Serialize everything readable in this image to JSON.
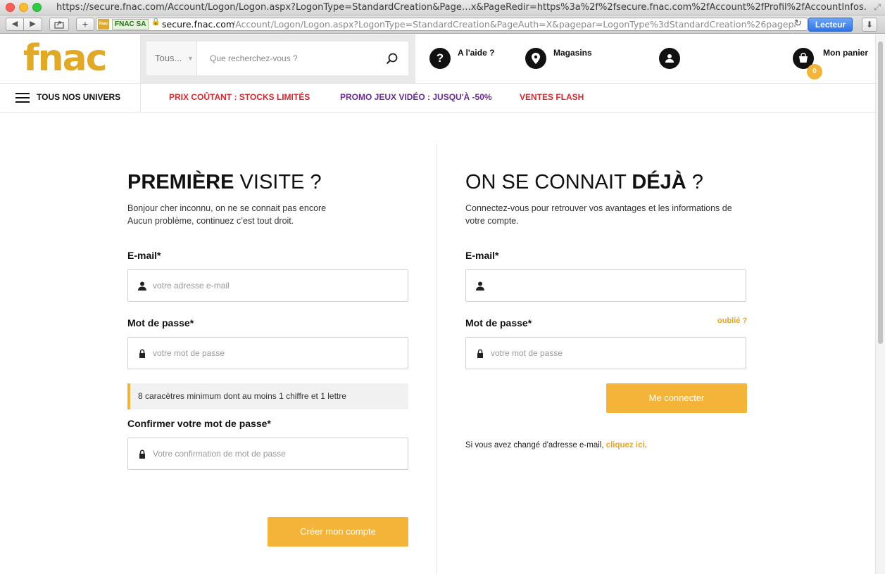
{
  "browser": {
    "window_title": "https://secure.fnac.com/Account/Logon/Logon.aspx?LogonType=StandardCreation&Page…x&PageRedir=https%3a%2f%2fsecure.fnac.com%2fAccount%2fProfil%2fAccountInfos.aspx",
    "site_badge": "FNAC SA",
    "site_mini_logo": "fnac",
    "url_domain": "secure.fnac.com",
    "url_path": "/Account/Logon/Logon.aspx?LogonType=StandardCreation&PageAuth=X&pagepar=LogonType%3dStandardCreation%26pagepar%3dLog",
    "reader_label": "Lecteur",
    "icons": [
      "back-icon",
      "forward-icon",
      "share-icon",
      "plus-icon",
      "lock-icon",
      "reload-icon",
      "download-icon"
    ]
  },
  "header": {
    "logo": "fnac",
    "search": {
      "category": "Tous...",
      "placeholder": "Que recherchez-vous ?"
    },
    "help_label": "A l'aide ?",
    "help_glyph": "?",
    "stores_label": "Magasins",
    "cart_label": "Mon panier",
    "cart_count": "0"
  },
  "subnav": {
    "univers_label": "TOUS NOS UNIVERS",
    "promos": [
      {
        "label": "PRIX COÛTANT : STOCKS LIMITÉS",
        "color": "#d7282f"
      },
      {
        "label": "PROMO JEUX VIDÉO : JUSQU'À -50%",
        "color": "#6b2c91"
      },
      {
        "label": "VENTES FLASH",
        "color": "#d7282f"
      }
    ]
  },
  "signup": {
    "title_bold": "PREMIÈRE",
    "title_light": " VISITE ?",
    "intro_line1": "Bonjour cher inconnu, on ne se connait pas encore",
    "intro_line2": "Aucun problème, continuez c’est tout droit.",
    "email_label": "E-mail*",
    "email_placeholder": "votre adresse e-mail",
    "password_label": "Mot de passe*",
    "password_placeholder": "votre mot de passe",
    "password_hint": "8 caracètres minimum dont au moins 1 chiffre et 1 lettre",
    "confirm_label": "Confirmer votre mot de passe*",
    "confirm_placeholder": "Votre confirmation de mot de passe",
    "submit_label": "Créer mon compte"
  },
  "login": {
    "title_light": "ON SE CONNAIT ",
    "title_bold": "DÉJÀ",
    "title_end": " ?",
    "intro_line1": "Connectez-vous pour retrouver vos avantages et les informations de",
    "intro_line2": "votre compte.",
    "email_label": "E-mail*",
    "email_value": "",
    "password_label": "Mot de passe*",
    "forgot_label": "oublié ?",
    "password_placeholder": "votre mot de passe",
    "submit_label": "Me connecter",
    "changed_text": "Si vous avez changé d'adresse e-mail, ",
    "changed_link": "cliquez ici",
    "changed_end": "."
  },
  "colors": {
    "accent": "#f4b43a",
    "logo": "#e1a925",
    "promo_red": "#d7282f",
    "promo_purple": "#6b2c91"
  }
}
